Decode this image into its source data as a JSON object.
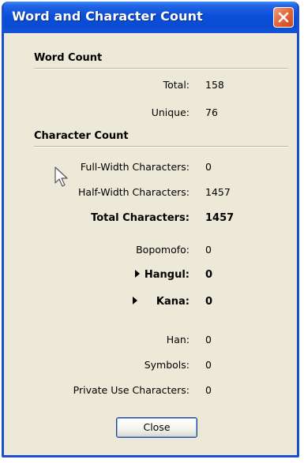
{
  "window": {
    "title": "Word and Character Count"
  },
  "word_count": {
    "heading": "Word Count",
    "rows": [
      {
        "label": "Total:",
        "value": "158"
      },
      {
        "label": "Unique:",
        "value": "76"
      }
    ]
  },
  "character_count": {
    "heading": "Character Count",
    "rows": [
      {
        "label": "Full-Width Characters:",
        "value": "0"
      },
      {
        "label": "Half-Width Characters:",
        "value": "1457"
      },
      {
        "label": "Total Characters:",
        "value": "1457"
      },
      {
        "label": "Bopomofo:",
        "value": "0"
      },
      {
        "label": "Hangul:",
        "value": "0"
      },
      {
        "label": "Kana:",
        "value": "0"
      },
      {
        "label": "Han:",
        "value": "0"
      },
      {
        "label": "Symbols:",
        "value": "0"
      },
      {
        "label": "Private Use Characters:",
        "value": "0"
      }
    ]
  },
  "buttons": {
    "close_label": "Close"
  },
  "icons": {
    "close": "close-icon",
    "expand": "expand-arrow-icon",
    "cursor": "mouse-pointer-icon"
  },
  "colors": {
    "titlebar": "#0a4fd8",
    "close_button": "#e36a40",
    "dialog_background": "#ece9d8"
  }
}
